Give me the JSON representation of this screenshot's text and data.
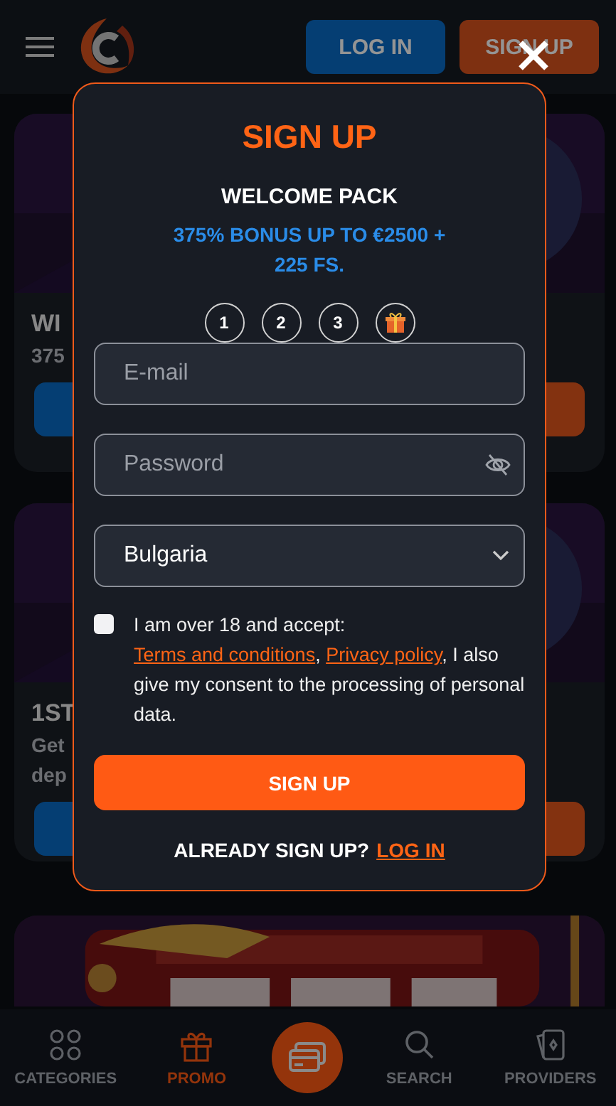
{
  "header": {
    "buttons": [
      {
        "label": "LOG IN",
        "kind": "login"
      },
      {
        "label": "SIGN UP",
        "kind": "signup"
      }
    ]
  },
  "cards": [
    {
      "kind": "promo",
      "title": "WI",
      "lines": [
        "375"
      ]
    },
    {
      "kind": "promo",
      "title": "1ST",
      "lines": [
        "Get",
        "dep"
      ]
    },
    {
      "kind": "picture"
    }
  ],
  "modal": {
    "title": "SIGN UP",
    "subtitle": "WELCOME PACK",
    "bonus": "375% BONUS UP TO €2500 + 225 FS.",
    "steps": [
      {
        "kind": "number",
        "label": "1"
      },
      {
        "kind": "number",
        "label": "2"
      },
      {
        "kind": "number",
        "label": "3"
      },
      {
        "kind": "gift"
      }
    ],
    "email": {
      "placeholder": "E-mail"
    },
    "password": {
      "placeholder": "Password"
    },
    "country": {
      "value": "Bulgaria"
    },
    "consent": {
      "checked": false,
      "parts": [
        {
          "kind": "text",
          "text": "I am over 18 and accept: "
        },
        {
          "kind": "link",
          "text": "Terms and conditions"
        },
        {
          "kind": "text",
          "text": ", "
        },
        {
          "kind": "link",
          "text": "Privacy policy"
        },
        {
          "kind": "text",
          "text": ", I also give my consent to the processing of personal data."
        }
      ]
    },
    "submit": "SIGN UP",
    "footer": {
      "text": "ALREADY SIGN UP?",
      "link": "LOG IN"
    }
  },
  "bottom_nav": [
    {
      "kind": "categories",
      "label": "CATEGORIES",
      "selected": false
    },
    {
      "kind": "promo",
      "label": "PROMO",
      "selected": true
    },
    {
      "kind": "center"
    },
    {
      "kind": "search",
      "label": "SEARCH",
      "selected": false
    },
    {
      "kind": "providers",
      "label": "PROVIDERS",
      "selected": false
    }
  ]
}
